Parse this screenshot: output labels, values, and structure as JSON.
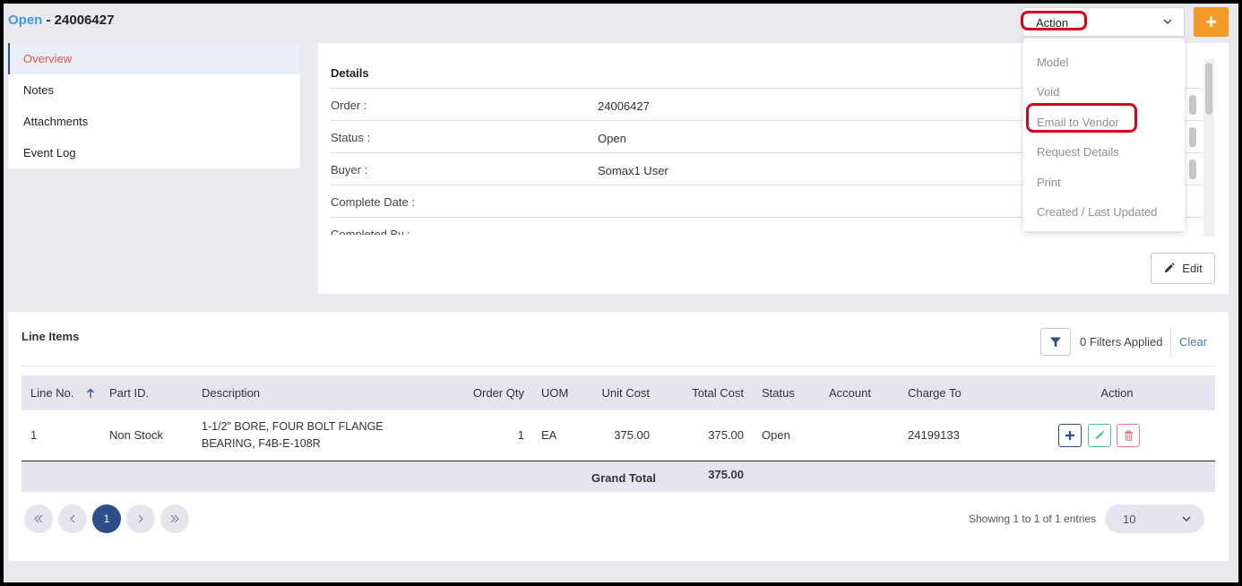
{
  "header": {
    "status": "Open",
    "title": "- 24006427",
    "action_label": "Action",
    "add_label": "+"
  },
  "action_menu": {
    "items": [
      "Model",
      "Void",
      "Email to Vendor",
      "Request Details",
      "Print",
      "Created / Last Updated"
    ]
  },
  "sidebar": {
    "items": [
      {
        "label": "Overview",
        "active": true
      },
      {
        "label": "Notes",
        "active": false
      },
      {
        "label": "Attachments",
        "active": false
      },
      {
        "label": "Event Log",
        "active": false
      }
    ]
  },
  "details": {
    "heading": "Details",
    "rows": [
      {
        "label": "Order :",
        "value": "24006427"
      },
      {
        "label": "Status :",
        "value": "Open"
      },
      {
        "label": "Buyer :",
        "value": "Somax1 User"
      },
      {
        "label": "Complete Date :",
        "value": ""
      },
      {
        "label": "Completed By :",
        "value": ""
      }
    ],
    "edit_label": "Edit"
  },
  "line_items": {
    "heading": "Line Items",
    "filters_text": "0 Filters Applied",
    "clear_label": "Clear",
    "columns": [
      "Line No.",
      "Part ID.",
      "Description",
      "Order Qty",
      "UOM",
      "Unit Cost",
      "Total Cost",
      "Status",
      "Account",
      "Charge To",
      "Action"
    ],
    "rows": [
      {
        "line_no": "1",
        "part_id": "Non Stock",
        "description": "1-1/2\" BORE, FOUR BOLT FLANGE BEARING, F4B-E-108R",
        "order_qty": "1",
        "uom": "EA",
        "unit_cost": "375.00",
        "total_cost": "375.00",
        "status": "Open",
        "account": "",
        "charge_to": "24199133"
      }
    ],
    "grand_total_label": "Grand Total",
    "grand_total_value": "375.00"
  },
  "pagination": {
    "current_page": "1",
    "showing_text": "Showing 1 to 1 of 1 entries",
    "page_size": "10"
  },
  "colors": {
    "accent_orange": "#f39a28",
    "status_blue": "#3d9be9",
    "highlight_red": "#d9001b",
    "navy": "#2c4e8a"
  }
}
